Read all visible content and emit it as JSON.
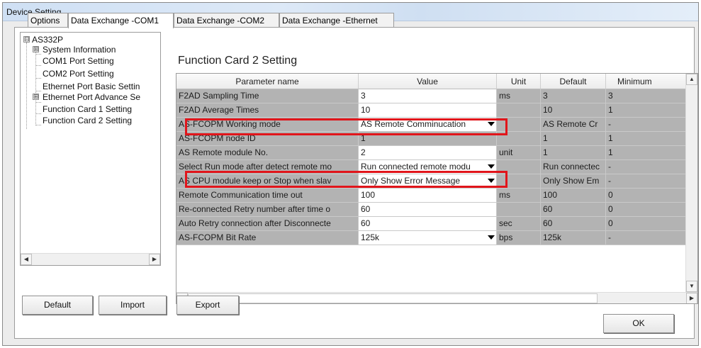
{
  "window": {
    "title": "Device Setting"
  },
  "tabs": [
    "Options",
    "Data Exchange -COM1",
    "Data Exchange -COM2",
    "Data Exchange -Ethernet"
  ],
  "tree": {
    "root": "AS332P",
    "items": [
      "System Information",
      "COM1 Port Setting",
      "COM2 Port Setting",
      "Ethernet Port Basic Settin",
      "Ethernet Port Advance Se",
      "Function Card 1 Setting",
      "Function Card 2 Setting"
    ],
    "toggle_collapse": "⊟",
    "toggle_expand": "⊞"
  },
  "section_title": "Function Card 2 Setting",
  "grid": {
    "headers": [
      "Parameter name",
      "Value",
      "Unit",
      "Default",
      "Minimum"
    ],
    "rows": [
      {
        "name": "F2AD Sampling Time",
        "value": "3",
        "unit": "ms",
        "default": "3",
        "min": "3",
        "editable": true
      },
      {
        "name": "F2AD Average Times",
        "value": "10",
        "unit": "",
        "default": "10",
        "min": "1",
        "editable": true
      },
      {
        "name": "AS-FCOPM Working mode",
        "value": "AS Remote Comminucation",
        "unit": "",
        "default": "AS Remote Cr",
        "min": "-",
        "editable": true,
        "dropdown": true
      },
      {
        "name": "AS-FCOPM node ID",
        "value": "1",
        "unit": "",
        "default": "1",
        "min": "1",
        "editable": false
      },
      {
        "name": "AS Remote module No.",
        "value": "2",
        "unit": "unit",
        "default": "1",
        "min": "1",
        "editable": true
      },
      {
        "name": "Select Run mode after detect remote mo",
        "value": "Run connected remote modu",
        "unit": "",
        "default": "Run connectec",
        "min": "-",
        "editable": true,
        "dropdown": true
      },
      {
        "name": "AS CPU module keep or Stop when slav",
        "value": "Only Show Error Message",
        "unit": "",
        "default": "Only Show Em",
        "min": "-",
        "editable": true,
        "dropdown": true
      },
      {
        "name": "Remote Communication time out",
        "value": "100",
        "unit": "ms",
        "default": "100",
        "min": "0",
        "editable": true
      },
      {
        "name": "Re-connected Retry number after time o",
        "value": "60",
        "unit": "",
        "default": "60",
        "min": "0",
        "editable": true
      },
      {
        "name": "Auto Retry connection after Disconnecte",
        "value": "60",
        "unit": "sec",
        "default": "60",
        "min": "0",
        "editable": true
      },
      {
        "name": "AS-FCOPM Bit Rate",
        "value": "125k",
        "unit": "bps",
        "default": "125k",
        "min": "-",
        "editable": true,
        "dropdown": true
      }
    ]
  },
  "buttons": {
    "default": "Default",
    "import": "Import",
    "export": "Export",
    "ok": "OK"
  },
  "colors": {
    "highlight": "#e1151b",
    "disabled_cell": "#b3b3b3"
  }
}
